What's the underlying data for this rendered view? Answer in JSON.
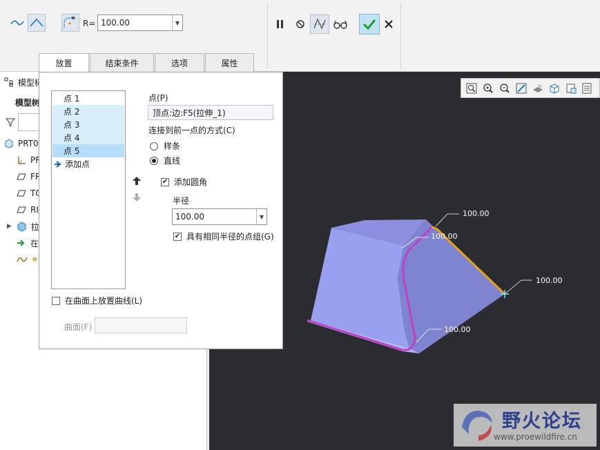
{
  "ribbon": {
    "radius_label": "R=",
    "radius_value": "100.00"
  },
  "tabs": [
    {
      "label": "放置"
    },
    {
      "label": "结束条件"
    },
    {
      "label": "选项"
    },
    {
      "label": "属性"
    }
  ],
  "tree": {
    "header_label": "模型树",
    "sub_label": "模型树",
    "items": [
      {
        "label": "PRT0"
      },
      {
        "label": "PR"
      },
      {
        "label": "FR"
      },
      {
        "label": "TO"
      },
      {
        "label": "RI"
      },
      {
        "label": "拉"
      },
      {
        "label": "在"
      },
      {
        "label": "※"
      }
    ]
  },
  "panel": {
    "points": [
      {
        "label": "点 1"
      },
      {
        "label": "点 2"
      },
      {
        "label": "点 3"
      },
      {
        "label": "点 4"
      },
      {
        "label": "点 5"
      }
    ],
    "add_point_label": "添加点",
    "point_label": "点(P)",
    "point_value": "顶点:边:F5(拉伸_1)",
    "connect_label": "连接到前一点的方式(C)",
    "option_spline": "样条",
    "option_line": "直线",
    "add_fillet_label": "添加圆角",
    "radius_label": "半径",
    "radius_value": "100.00",
    "same_radius_label": "具有相同半径的点组(G)",
    "place_on_surface_label": "在曲面上放置曲线(L)",
    "surface_label": "曲面(F)"
  },
  "graphics": {
    "dimension_labels": [
      "100.00",
      "100.00",
      "100.00",
      "100.00"
    ],
    "accent_color": "#e8a020",
    "highlight_color": "#c040c8"
  },
  "watermark": {
    "title": "野火论坛",
    "url": "www.proewildfire.cn"
  }
}
